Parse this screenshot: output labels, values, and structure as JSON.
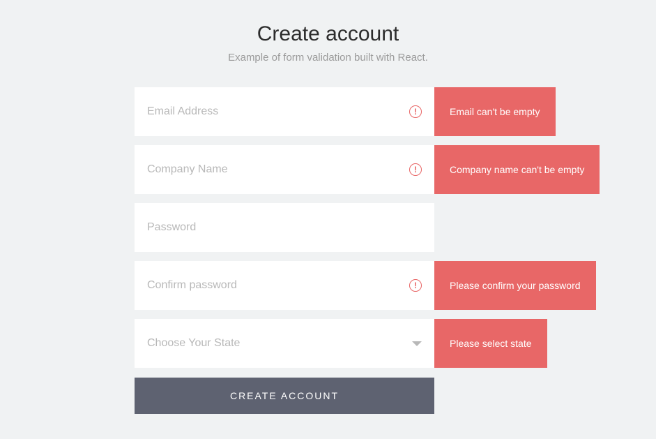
{
  "header": {
    "title": "Create account",
    "subtitle": "Example of form validation built with React."
  },
  "fields": {
    "email": {
      "placeholder": "Email Address",
      "error": "Email can't be empty"
    },
    "company": {
      "placeholder": "Company Name",
      "error": "Company name can't be empty"
    },
    "password": {
      "placeholder": "Password"
    },
    "confirm": {
      "placeholder": "Confirm password",
      "error": "Please confirm your password"
    },
    "state": {
      "placeholder": "Choose Your State",
      "error": "Please select state"
    }
  },
  "submit": {
    "label": "CREATE ACCOUNT"
  }
}
